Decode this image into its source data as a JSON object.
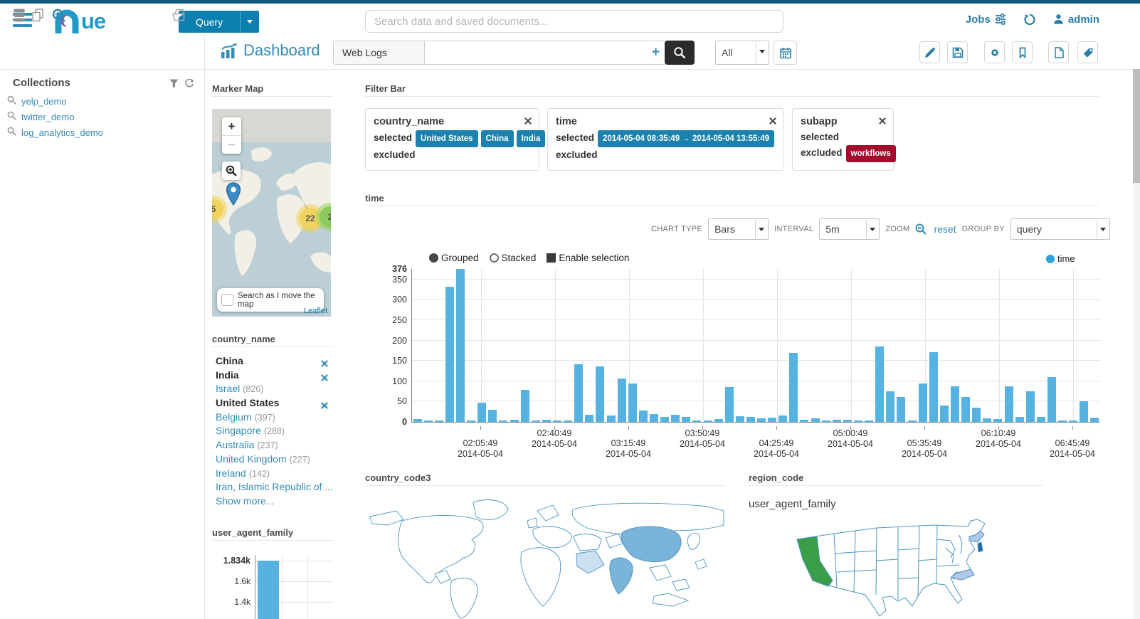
{
  "navbar": {
    "logo_text": "ue",
    "query_label": "Query",
    "search_placeholder": "Search data and saved documents...",
    "jobs_label": "Jobs",
    "user_label": "admin"
  },
  "sidebar": {
    "collections_title": "Collections",
    "items": [
      {
        "label": "yelp_demo"
      },
      {
        "label": "twitter_demo"
      },
      {
        "label": "log_analytics_demo"
      }
    ]
  },
  "toolbar": {
    "title": "Dashboard",
    "index_label": "Web Logs",
    "search_value": "",
    "add_label": "+",
    "scope_value": "All"
  },
  "filter_bar": {
    "title": "Filter Bar",
    "selected_label": "selected",
    "excluded_label": "excluded",
    "cards": [
      {
        "name": "country_name",
        "selected": [
          "United States",
          "China",
          "India"
        ],
        "excluded": []
      },
      {
        "name": "time",
        "selected": [
          "2014-05-04  08:35:49 → 2014-05-04  13:55:49"
        ],
        "excluded": []
      },
      {
        "name": "subapp",
        "selected": [],
        "excluded": [
          "workflows"
        ]
      }
    ]
  },
  "time_widget": {
    "title": "time",
    "chart_type_label": "CHART TYPE",
    "chart_type_value": "Bars",
    "interval_label": "INTERVAL",
    "interval_value": "5m",
    "zoom_label": "ZOOM",
    "zoom_reset": "reset",
    "group_by_label": "GROUP BY",
    "group_by_value": "query",
    "radio_grouped": "Grouped",
    "radio_stacked": "Stacked",
    "checkbox_selection": "Enable selection",
    "legend": "time"
  },
  "chart_data": [
    {
      "type": "bar",
      "title": "time",
      "legend": [
        "time"
      ],
      "ylim": [
        0,
        376
      ],
      "y_ticks": [
        376,
        350,
        300,
        250,
        200,
        150,
        100,
        50,
        0
      ],
      "x_ticks": [
        {
          "time": "02:05:49",
          "date": "2014-05-04"
        },
        {
          "time": "02:40:49",
          "date": "2014-05-04"
        },
        {
          "time": "03:15:49",
          "date": "2014-05-04"
        },
        {
          "time": "03:50:49",
          "date": "2014-05-04"
        },
        {
          "time": "04:25:49",
          "date": "2014-05-04"
        },
        {
          "time": "05:00:49",
          "date": "2014-05-04"
        },
        {
          "time": "05:35:49",
          "date": "2014-05-04"
        },
        {
          "time": "06:10:49",
          "date": "2014-05-04"
        },
        {
          "time": "06:45:49",
          "date": "2014-05-04"
        }
      ],
      "series": [
        {
          "name": "time",
          "values": [
            7,
            3,
            3,
            333,
            376,
            3,
            48,
            29,
            2,
            6,
            79,
            2,
            6,
            2,
            2,
            142,
            18,
            137,
            15,
            107,
            94,
            28,
            20,
            12,
            18,
            13,
            3,
            2,
            7,
            85,
            14,
            12,
            9,
            11,
            15,
            170,
            5,
            8,
            2,
            6,
            5,
            2,
            2,
            185,
            75,
            62,
            3,
            95,
            172,
            40,
            88,
            62,
            35,
            8,
            7,
            88,
            12,
            75,
            12,
            110,
            4,
            3,
            50,
            10
          ]
        }
      ],
      "bar_color": "#55b2e1",
      "grid": true,
      "legend_position": "top-right"
    },
    {
      "type": "bar",
      "title": "user_agent_family",
      "y_ticks": [
        "1.834k",
        "1.6k",
        "1.4k"
      ],
      "values": [
        1834
      ],
      "ylim_top": 1834,
      "bar_color": "#55b2e1",
      "note": "partially visible at bottom of viewport"
    },
    {
      "type": "heatmap",
      "title": "country_code3",
      "highlighted": [
        "China",
        "India"
      ],
      "highlighted_light": [
        "Saudi Arabia"
      ]
    },
    {
      "type": "heatmap",
      "title": "region_code",
      "highlighted": [
        {
          "state": "California",
          "color": "#3a9e49"
        },
        {
          "state": "New York",
          "color": "#aec6e8"
        },
        {
          "state": "New Jersey",
          "color": "#2166ac"
        },
        {
          "state": "North Carolina",
          "color": "#b5c7e9"
        }
      ]
    }
  ],
  "marker_map": {
    "title": "Marker Map",
    "zoom_in_label": "+",
    "zoom_out_label": "−",
    "clusters": [
      {
        "label": "5",
        "color": "yellow"
      },
      {
        "label": "22",
        "color": "yellow"
      },
      {
        "label": "2",
        "color": "green"
      }
    ],
    "search_checkbox_label": "Search as I move the map",
    "attribution": "Leaflet"
  },
  "country_name_facet": {
    "title": "country_name",
    "items": [
      {
        "label": "China",
        "selected": true
      },
      {
        "label": "India",
        "selected": true
      },
      {
        "label": "Israel",
        "count": "826"
      },
      {
        "label": "United States",
        "selected": true
      },
      {
        "label": "Belgium",
        "count": "397"
      },
      {
        "label": "Singapore",
        "count": "288"
      },
      {
        "label": "Australia",
        "count": "237"
      },
      {
        "label": "United Kingdom",
        "count": "227"
      },
      {
        "label": "Ireland",
        "count": "142"
      },
      {
        "label": "Iran, Islamic Republic of ..."
      },
      {
        "label": "Show more...",
        "is_action": true
      }
    ]
  },
  "user_agent_family_widget": {
    "title": "user_agent_family"
  },
  "country_code3_widget": {
    "title": "country_code3"
  },
  "region_code_widget": {
    "title": "region_code",
    "overlay_label": "user_agent_family"
  },
  "colors": {
    "accent_blue": "#338bb8",
    "button_blue": "#0b7fad",
    "badge_blue": "#1b82ae",
    "badge_red": "#a30c2e",
    "bar_blue": "#55b2e1",
    "map_country_fill": "#7ab4d8",
    "map_country_fill_light": "#cde0ef",
    "topstrip_blue": "#15597e"
  }
}
